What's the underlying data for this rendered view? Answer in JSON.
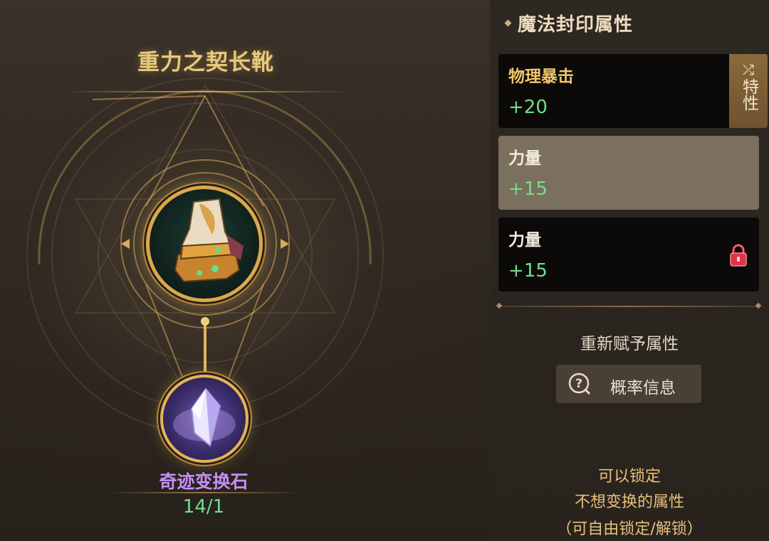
{
  "item": {
    "name": "重力之契长靴",
    "icon": "boots-icon"
  },
  "material": {
    "name": "奇迹变换石",
    "count": "14/1",
    "icon": "crystal-icon"
  },
  "panel": {
    "title": "魔法封印属性",
    "attributes": [
      {
        "name": "物理暴击",
        "value": "+20",
        "tag_label": "特性",
        "tag_symbol": "⤮",
        "state": "normal"
      },
      {
        "name": "力量",
        "value": "+15",
        "state": "selected"
      },
      {
        "name": "力量",
        "value": "+15",
        "state": "locked"
      }
    ],
    "reroll_label": "重新赋予属性",
    "probability_button": "概率信息",
    "hint_lines": [
      "可以锁定",
      "不想变换的属性",
      "（可自由锁定/解锁）"
    ]
  },
  "colors": {
    "gold": "#e8c97d",
    "green_value": "#6fe08a",
    "purple_name": "#c58df5",
    "lock_red": "#e0344a"
  }
}
